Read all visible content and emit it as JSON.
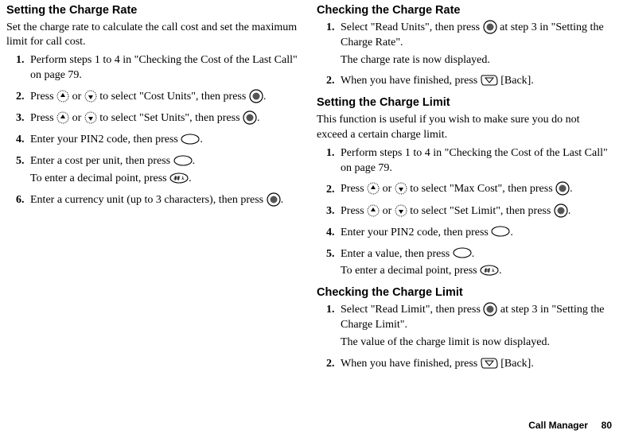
{
  "left": {
    "set_rate": {
      "heading": "Setting the Charge Rate",
      "intro": "Set the charge rate to calculate the call cost and set the maximum limit for call cost.",
      "s1": "Perform steps 1 to 4 in \"Checking the Cost of the Last Call\" on page 79.",
      "s2a": "Press ",
      "s2b": " or ",
      "s2c": " to select \"Cost Units\", then press ",
      "s2d": ".",
      "s3a": "Press ",
      "s3b": " or ",
      "s3c": " to select \"Set Units\", then press ",
      "s3d": ".",
      "s4a": "Enter your PIN2 code, then press ",
      "s4b": ".",
      "s5a": "Enter a cost per unit, then press ",
      "s5b": ".",
      "s5c": "To enter a decimal point, press ",
      "s5d": ".",
      "s6a": "Enter a currency unit (up to 3 characters), then press ",
      "s6b": "."
    }
  },
  "right": {
    "check_rate": {
      "heading": "Checking the Charge Rate",
      "s1a": "Select \"Read Units\", then press ",
      "s1b": " at step 3 in \"Setting the Charge Rate\".",
      "s1c": "The charge rate is now displayed.",
      "s2a": "When you have finished, press ",
      "s2b": " [Back]."
    },
    "set_limit": {
      "heading": "Setting the Charge Limit",
      "intro": "This function is useful if you wish to make sure you do not exceed a certain charge limit.",
      "s1": "Perform steps 1 to 4 in \"Checking the Cost of the Last Call\" on page 79.",
      "s2a": "Press ",
      "s2b": " or ",
      "s2c": " to select \"Max Cost\", then press ",
      "s2d": ".",
      "s3a": "Press ",
      "s3b": " or ",
      "s3c": " to select \"Set Limit\", then press ",
      "s3d": ".",
      "s4a": "Enter your PIN2 code, then press ",
      "s4b": ".",
      "s5a": "Enter a value, then press ",
      "s5b": ".",
      "s5c": "To enter a decimal point, press ",
      "s5d": "."
    },
    "check_limit": {
      "heading": "Checking the Charge Limit",
      "s1a": "Select \"Read Limit\", then press ",
      "s1b": " at step 3 in \"Setting the Charge Limit\".",
      "s1c": "The value of the charge limit is now displayed.",
      "s2a": "When you have finished, press ",
      "s2b": " [Back]."
    }
  },
  "footer": {
    "label": "Call Manager",
    "page": "80"
  }
}
